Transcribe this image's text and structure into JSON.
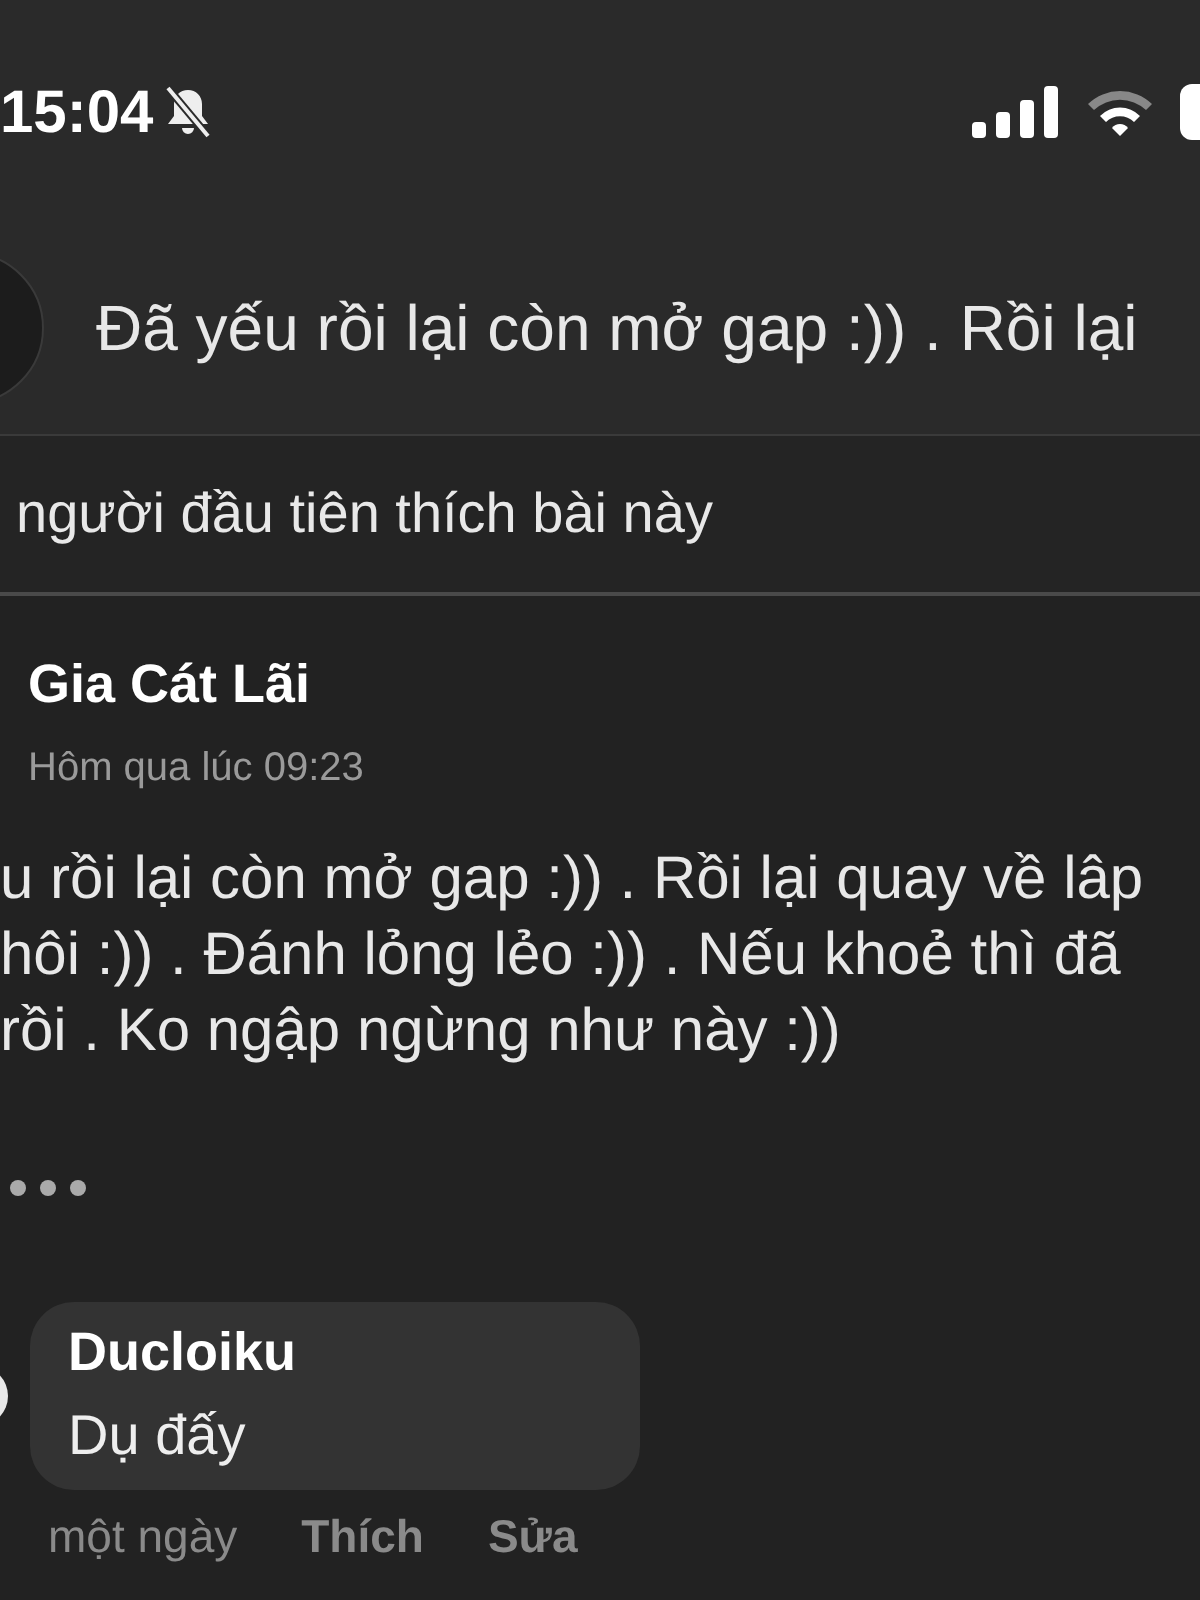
{
  "status_bar": {
    "time": "15:04",
    "muted": true
  },
  "post_header": {
    "text": "Đã yếu rồi lại còn mở gap :)) . Rồi lại"
  },
  "likes": {
    "text": "người đầu tiên thích bài này"
  },
  "post": {
    "author": "Gia Cát Lãi",
    "time": "Hôm qua lúc 09:23",
    "lines": [
      "u rồi lại còn mở gap :)) . Rồi lại quay về lâp",
      "hôi :)) . Đánh lỏng lẻo :)) . Nếu khoẻ thì đã",
      "rồi . Ko ngập ngừng như này :))"
    ]
  },
  "comment": {
    "author": "Ducloiku",
    "text": "Dụ đấy",
    "time": "một ngày",
    "actions": [
      "Thích",
      "Sửa"
    ]
  }
}
